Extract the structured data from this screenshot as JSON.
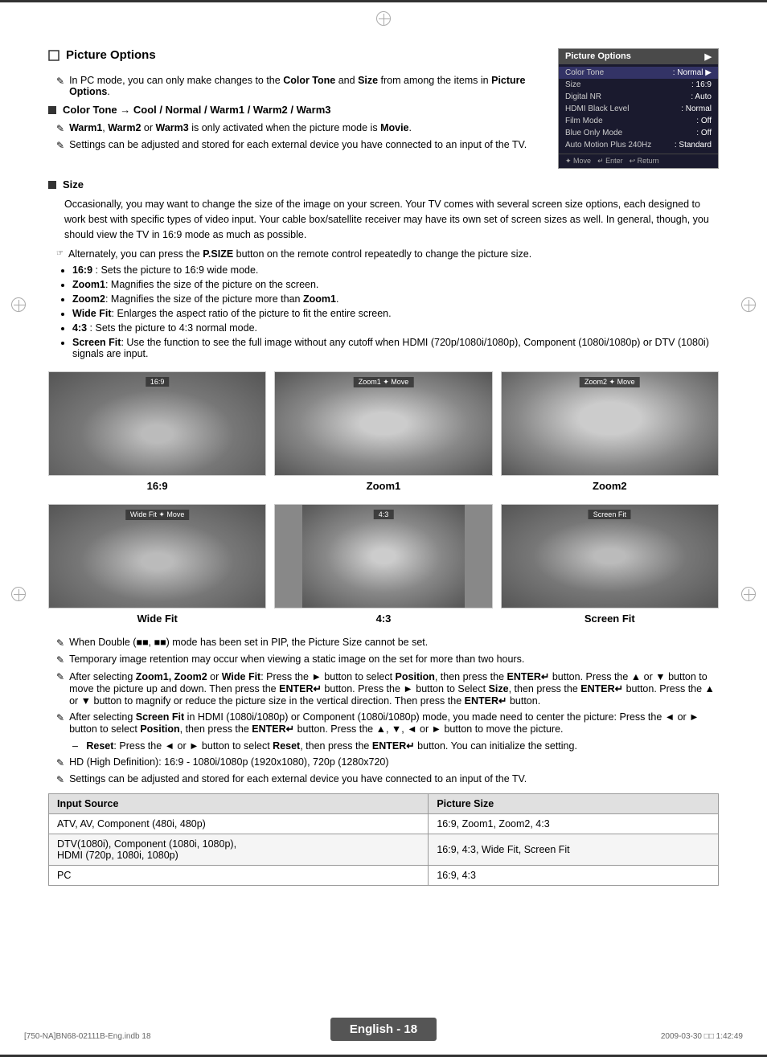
{
  "page": {
    "title": "Picture Options",
    "footer_text": "English - 18",
    "footer_left": "[750-NA]BN68-02111B-Eng.indb   18",
    "footer_right": "2009-03-30   □□  1:42:49"
  },
  "picture_options": {
    "heading": "Picture Options",
    "note1": "In PC mode, you can only make changes to the Color Tone and Size from among the items in Picture Options.",
    "color_tone_label": "Color Tone",
    "color_tone_values": "Cool / Normal / Warm1 / Warm2 / Warm3",
    "note2": "Warm1, Warm2 or Warm3 is only activated when the picture mode is Movie.",
    "note3": "Settings can be adjusted and stored for each external device you have connected to an input of the TV.",
    "size_heading": "Size",
    "size_desc": "Occasionally, you may want to change the size of the image on your screen. Your TV comes with several screen size options, each designed to work best with specific types of video input. Your cable box/satellite receiver may have its own set of screen sizes as well. In general, though, you should view the TV in 16:9 mode as much as possible.",
    "size_note_psize": "Alternately, you can press the P.SIZE button on the remote control repeatedly to change the picture size.",
    "size_options": [
      {
        "label": "16:9",
        "desc": ": Sets the picture to 16:9 wide mode."
      },
      {
        "label": "Zoom1",
        "desc": ": Magnifies the size of the picture on the screen."
      },
      {
        "label": "Zoom2",
        "desc": ": Magnifies the size of the picture more than Zoom1."
      },
      {
        "label": "Wide Fit",
        "desc": ": Enlarges the aspect ratio of the picture to fit the entire screen."
      },
      {
        "label": "4:3",
        "desc": ": Sets the picture to 4:3 normal mode."
      },
      {
        "label": "Screen Fit",
        "desc": ": Use the function to see the full image without any cutoff when HDMI (720p/1080i/1080p), Component (1080i/1080p) or DTV (1080i) signals are input."
      }
    ],
    "images": [
      {
        "label": "16:9",
        "caption": "16:9",
        "bar_text": "16:9"
      },
      {
        "label": "Zoom1",
        "caption": "Zoom1",
        "bar_text": "Zoom1 ✦ Move"
      },
      {
        "label": "Zoom2",
        "caption": "Zoom2",
        "bar_text": "Zoom2 ✦ Move"
      },
      {
        "label": "Wide Fit",
        "caption": "Wide Fit",
        "bar_text": "Wide Fit ✦ Move"
      },
      {
        "label": "4:3",
        "caption": "4:3",
        "bar_text": "4:3"
      },
      {
        "label": "Screen Fit",
        "caption": "Screen Fit",
        "bar_text": "Screen Fit"
      }
    ],
    "after_notes": [
      "When Double (■■, ■■) mode has been set in PIP, the Picture Size cannot be set.",
      "Temporary image retention may occur when viewing a static image on the set for more than two hours.",
      "After selecting Zoom1, Zoom2 or Wide Fit: Press the ► button to select Position, then press the ENTER↵ button. Press the ▲ or ▼ button to move the picture up and down. Then press the ENTER↵ button. Press the ► button to Select Size, then press the ENTER↵ button. Press the ▲ or ▼ button to magnify or reduce the picture size in the vertical direction. Then press the ENTER↵ button.",
      "After selecting Screen Fit in HDMI (1080i/1080p) or Component (1080i/1080p) mode, you made need to center the picture: Press the ◄ or ► button to select Position, then press the ENTER↵ button. Press the ▲, ▼, ◄ or ► button to move the picture.",
      "– Reset: Press the ◄ or ► button to select Reset, then press the ENTER↵ button. You can initialize the setting.",
      "HD (High Definition): 16:9 - 1080i/1080p (1920x1080), 720p (1280x720)",
      "Settings can be adjusted and stored for each external device you have connected to an input of the TV."
    ],
    "table": {
      "headers": [
        "Input Source",
        "Picture Size"
      ],
      "rows": [
        [
          "ATV, AV, Component (480i, 480p)",
          "16:9, Zoom1, Zoom2, 4:3"
        ],
        [
          "DTV(1080i), Component (1080i, 1080p),\nHDMI (720p, 1080i, 1080p)",
          "16:9, 4:3, Wide Fit, Screen Fit"
        ],
        [
          "PC",
          "16:9, 4:3"
        ]
      ]
    }
  },
  "panel": {
    "title": "Picture Options",
    "rows": [
      {
        "label": "Color Tone",
        "value": ": Normal",
        "active": true
      },
      {
        "label": "Size",
        "value": ": 16:9",
        "active": false
      },
      {
        "label": "Digital NR",
        "value": ": Auto",
        "active": false
      },
      {
        "label": "HDMI Black Level",
        "value": ": Normal",
        "active": false
      },
      {
        "label": "Film Mode",
        "value": ": Off",
        "active": false
      },
      {
        "label": "Blue Only Mode",
        "value": ": Off",
        "active": false
      },
      {
        "label": "Auto Motion Plus 240Hz",
        "value": ": Standard",
        "active": false
      }
    ],
    "footer": [
      "✦ Move",
      "↵ Enter",
      "↩ Return"
    ]
  }
}
